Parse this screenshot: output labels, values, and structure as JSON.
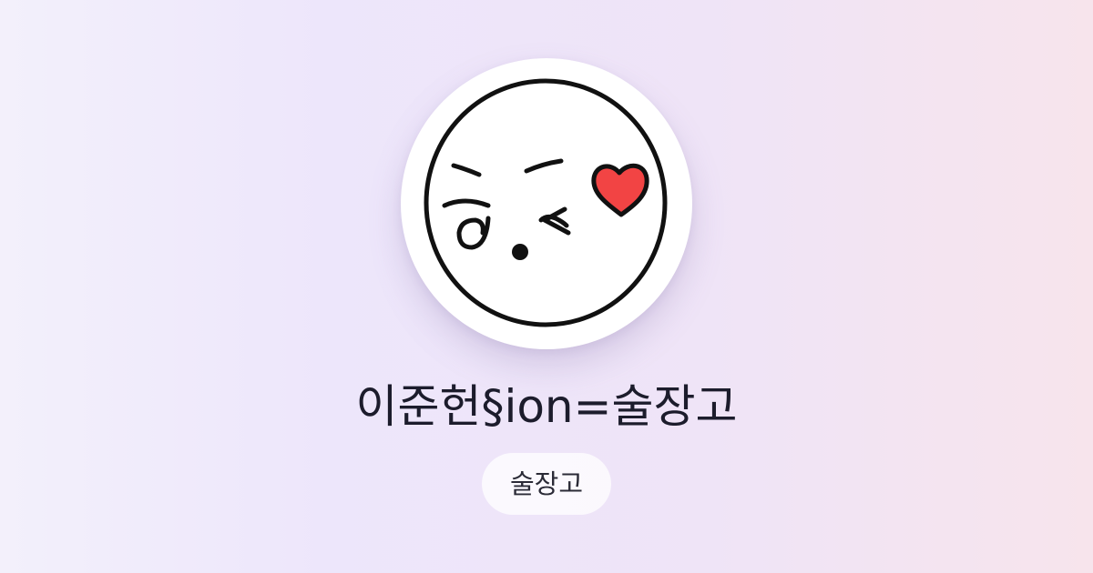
{
  "profile": {
    "name": "이준헌§ion=술장고",
    "avatar_icon": "winking-face-with-heart-icon",
    "heart_color": "#f24444"
  },
  "tag": {
    "label": "술장고"
  },
  "colors": {
    "title_text": "#1c1c2c",
    "chip_background": "#ffffff"
  }
}
